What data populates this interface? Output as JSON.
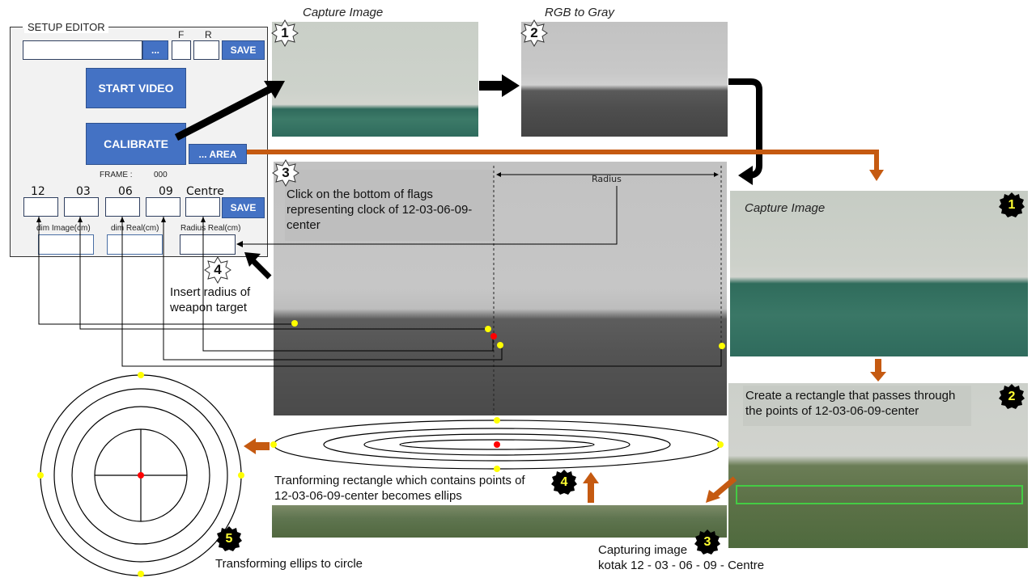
{
  "setup_editor": {
    "title": "SETUP EDITOR",
    "file_path_value": "",
    "browse_button": "...",
    "f_label": "F",
    "r_label": "R",
    "f_value": "",
    "r_value": "",
    "save_top": "SAVE",
    "start_video": "START VIDEO",
    "calibrate": "CALIBRATE",
    "area_button": "... AREA",
    "frame_label": "FRAME :",
    "frame_value": "000",
    "clock_labels": [
      "12",
      "03",
      "06",
      "09",
      "Centre"
    ],
    "clock_values": [
      "",
      "",
      "",
      "",
      ""
    ],
    "save_bottom": "SAVE",
    "dim_image_label": "dim Image(cm)",
    "dim_real_label": "dim Real(cm)",
    "radius_real_label": "Radius Real(cm)",
    "dim_image_value": "",
    "dim_real_value": "",
    "radius_real_value": ""
  },
  "steps_top": [
    {
      "number": "1",
      "caption": "Capture Image"
    },
    {
      "number": "2",
      "caption": "RGB to Gray"
    },
    {
      "number": "3",
      "caption": "Click on the bottom  of flags representing clock of 12-03-06-09-center"
    },
    {
      "number": "4",
      "caption": "Insert radius of weapon target"
    }
  ],
  "radius_label": "Radius",
  "steps_right": [
    {
      "number": "1",
      "caption": "Capture Image"
    },
    {
      "number": "2",
      "caption": "Create a rectangle that passes through the points of 12-03-06-09-center"
    },
    {
      "number": "3",
      "caption_line1": "Capturing image",
      "caption_line2": "kotak 12 - 03 - 06 - 09 - Centre"
    },
    {
      "number": "4",
      "caption": "Tranforming rectangle which contains points of 12-03-06-09-center becomes ellips"
    },
    {
      "number": "5",
      "caption": "Transforming ellips to circle"
    }
  ],
  "colors": {
    "button_blue": "#4472c4",
    "arrow_orange": "#c55a11",
    "point_yellow": "#ffff00",
    "point_red": "#ff0000",
    "rect_green": "#44cc44",
    "badge_black": "#000000",
    "badge_number_yellow": "#ffff33"
  }
}
